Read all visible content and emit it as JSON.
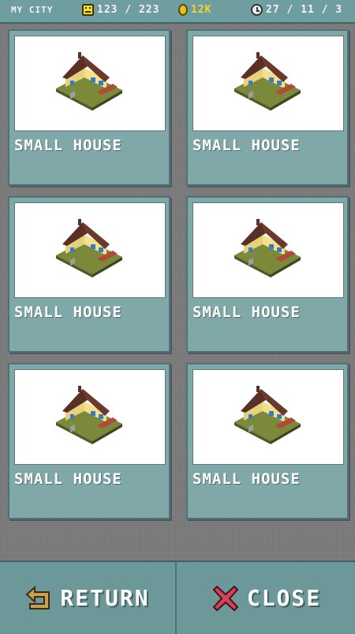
{
  "header": {
    "city_name": "MY CITY",
    "population": "123 / 223",
    "money": "12K",
    "date": "27 / 11 / 3",
    "icons": [
      "smiley-icon",
      "coin-icon",
      "clock-icon"
    ]
  },
  "buildings": [
    {
      "label": "SMALL HOUSE"
    },
    {
      "label": "SMALL HOUSE"
    },
    {
      "label": "SMALL HOUSE"
    },
    {
      "label": "SMALL HOUSE"
    },
    {
      "label": "SMALL HOUSE"
    },
    {
      "label": "SMALL HOUSE"
    }
  ],
  "footer": {
    "return_label": "RETURN",
    "close_label": "CLOSE"
  },
  "colors": {
    "topbar": "#6f9ea0",
    "card": "#81a8a9",
    "money_text": "#f4d42a",
    "close_icon": "#d0455a",
    "return_icon": "#c8a050"
  }
}
